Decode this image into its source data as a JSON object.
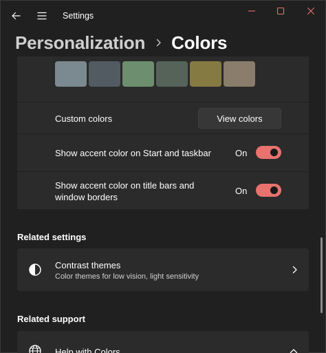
{
  "window": {
    "title": "Settings",
    "icons": {
      "back": "back-arrow-icon",
      "menu": "hamburger-menu-icon",
      "minimize": "minimize-icon",
      "maximize": "maximize-icon",
      "close": "close-icon"
    }
  },
  "breadcrumb": {
    "parent": "Personalization",
    "current": "Colors"
  },
  "accent_swatches": [
    "#7b8a91",
    "#525a62",
    "#6d8f6f",
    "#556359",
    "#857a42",
    "#8a7d6c"
  ],
  "custom_colors": {
    "label": "Custom colors",
    "button_label": "View colors"
  },
  "accent_start_taskbar": {
    "label": "Show accent color on Start and taskbar",
    "state_label": "On",
    "on": true
  },
  "accent_title_bars": {
    "label_line1": "Show accent color on title bars and",
    "label_line2": "window borders",
    "state_label": "On",
    "on": true
  },
  "related_settings": {
    "heading": "Related settings",
    "items": [
      {
        "title": "Contrast themes",
        "subtitle": "Color themes for low vision, light sensitivity",
        "icon": "contrast-icon"
      }
    ]
  },
  "related_support": {
    "heading": "Related support",
    "items": [
      {
        "title": "Help with Colors",
        "icon": "globe-icon"
      }
    ]
  },
  "colors": {
    "accent": "#e8726e",
    "background": "#202020",
    "card": "#2b2b2b"
  }
}
